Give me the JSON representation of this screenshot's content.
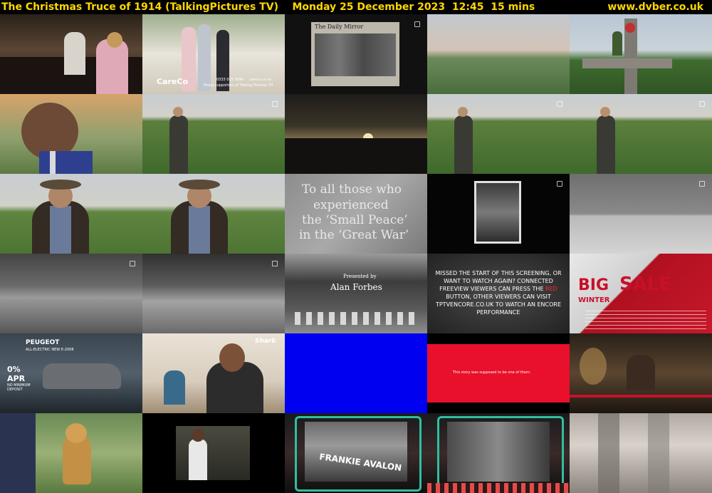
{
  "header": {
    "title": "The Christmas Truce of 1914 (TalkingPictures TV)",
    "date": "Monday 25 December 2023",
    "time": "12:45",
    "duration": "15 mins",
    "site": "www.dvber.co.uk"
  },
  "thumbnails": {
    "careco_logo": "CareCo",
    "careco_phone": "0333 015 5690",
    "careco_site": "careco.co.uk",
    "careco_caption": "Proud supporters of Talking Pictures TV",
    "mirror_headline": "The Daily Mirror",
    "quote_line1": "To all those who",
    "quote_line2": "experienced",
    "quote_line3": "the ‘Small Peace’",
    "quote_line4": "in the ‘Great War’",
    "presented_by": "Presented by",
    "presenter": "Alan Forbes",
    "encore_pre": "MISSED THE START OF THIS SCREENING, OR WANT TO WATCH AGAIN? CONNECTED FREEVIEW VIEWERS CAN PRESS THE ",
    "encore_red": "RED",
    "encore_post": " BUTTON, OTHER VIEWERS CAN VISIT TPTVENCORE.CO.UK TO WATCH AN ENCORE PERFORMANCE",
    "sale_big": "BIG",
    "sale_sale": "SALE",
    "sale_winter": "WINTER",
    "peugeot_brand": "PEUGEOT",
    "peugeot_model": "ALL-ELECTRIC NEW E-2008",
    "peugeot_apr": "0%",
    "peugeot_apr_label": "APR",
    "peugeot_deposit1": "NO MINIMUM",
    "peugeot_deposit2": "DEPOSIT",
    "shark_logo": "Shark",
    "bhf_story": "This story was supposed to be one of them.",
    "frankie": "FRANKIE AVALON"
  },
  "colors": {
    "header_text": "#ffd700",
    "encore_red": "#ff2a2a",
    "blue_screen": "#0000f0",
    "bhf_red": "#e8102a"
  }
}
